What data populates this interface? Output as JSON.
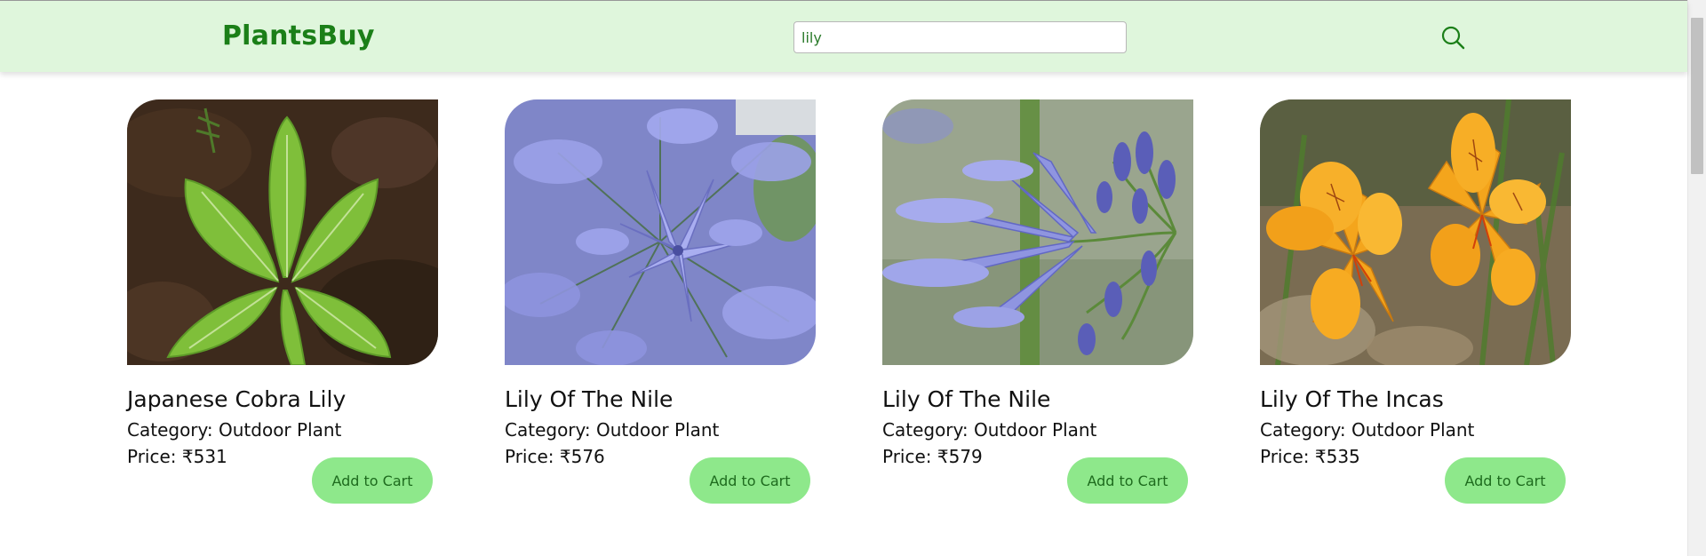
{
  "navbar": {
    "brand": "PlantsBuy",
    "search_value": "lily",
    "search_icon": "search-icon"
  },
  "products": [
    {
      "name": "Japanese Cobra Lily",
      "category": "Category: Outdoor Plant",
      "price": "Price: ₹531",
      "button_label": "Add to Cart",
      "image": "green-leaves-photo"
    },
    {
      "name": "Lily Of The Nile",
      "category": "Category: Outdoor Plant",
      "price": "Price: ₹576",
      "button_label": "Add to Cart",
      "image": "blue-agapanthus-photo"
    },
    {
      "name": "Lily Of The Nile",
      "category": "Category: Outdoor Plant",
      "price": "Price: ₹579",
      "button_label": "Add to Cart",
      "image": "blue-agapanthus-closeup-photo"
    },
    {
      "name": "Lily Of The Incas",
      "category": "Category: Outdoor Plant",
      "price": "Price: ₹535",
      "button_label": "Add to Cart",
      "image": "orange-alstroemeria-photo"
    }
  ],
  "colors": {
    "navbar_bg": "#dff6dc",
    "brand": "#1b7f18",
    "button_bg": "#8ee88b",
    "button_text": "#1e6b1e"
  }
}
